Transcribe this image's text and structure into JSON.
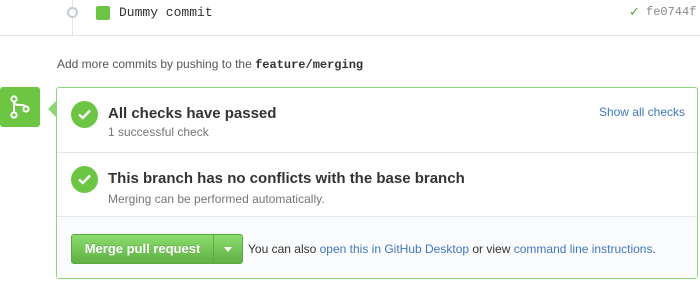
{
  "commit": {
    "message": "Dummy commit",
    "sha": "fe0744f",
    "status_icon": "check-icon",
    "avatar_color": "#6cc644"
  },
  "hint": {
    "prefix": "Add more commits by pushing to the ",
    "branch": "feature/merging"
  },
  "checks": {
    "title": "All checks have passed",
    "subtitle": "1 successful check",
    "show_all_label": "Show all checks"
  },
  "conflicts": {
    "title": "This branch has no conflicts with the base branch",
    "subtitle": "Merging can be performed automatically."
  },
  "merge": {
    "button_label": "Merge pull request",
    "also_prefix": "You can also ",
    "desktop_link": "open this in GitHub Desktop",
    "or_text": " or view ",
    "cli_link": "command line instructions",
    "suffix": "."
  },
  "colors": {
    "accent_green": "#6cc644",
    "link_blue": "#4078c0",
    "panel_border": "#8fd576"
  }
}
